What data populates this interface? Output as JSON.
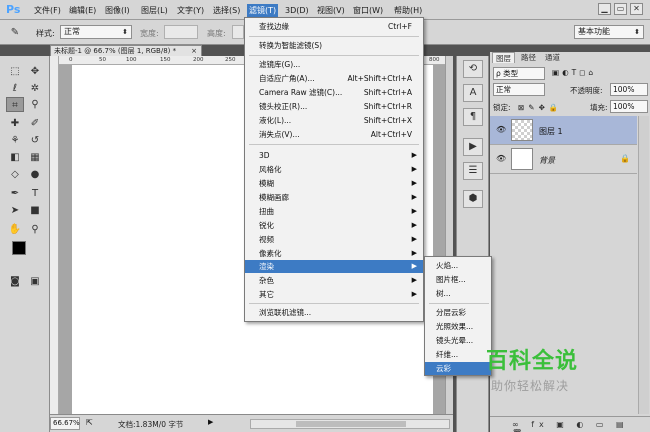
{
  "app": {
    "logo": "Ps"
  },
  "menubar": {
    "items": [
      "文件(F)",
      "编辑(E)",
      "图像(I)",
      "图层(L)",
      "文字(Y)",
      "选择(S)",
      "滤镜(T)",
      "3D(D)",
      "视图(V)",
      "窗口(W)",
      "帮助(H)"
    ],
    "window_buttons": [
      "▁",
      "▭",
      "✕"
    ]
  },
  "options": {
    "style_label": "样式:",
    "style_value": "正常",
    "width_label": "宽度:",
    "height_label": "高度:",
    "workspace": "基本功能"
  },
  "document": {
    "tab_title": "未标题-1 @ 66.7% (图层 1, RGB/8) *",
    "close": "×",
    "ruler_ticks": [
      "0",
      "50",
      "100",
      "150",
      "200",
      "250",
      "300",
      "350"
    ],
    "ruler_right_tick": "800",
    "zoom": "66.67%",
    "doc_info": "文档:1.83M/0 字节"
  },
  "filter_menu": {
    "items": [
      {
        "label": "查找边缘",
        "shortcut": "Ctrl+F"
      },
      {
        "label": "转换为智能滤镜(S)"
      },
      {
        "label": "滤镜库(G)..."
      },
      {
        "label": "自适应广角(A)...",
        "shortcut": "Alt+Shift+Ctrl+A"
      },
      {
        "label": "Camera Raw 滤镜(C)...",
        "shortcut": "Shift+Ctrl+A"
      },
      {
        "label": "镜头校正(R)...",
        "shortcut": "Shift+Ctrl+R"
      },
      {
        "label": "液化(L)...",
        "shortcut": "Shift+Ctrl+X"
      },
      {
        "label": "消失点(V)...",
        "shortcut": "Alt+Ctrl+V"
      },
      {
        "label": "3D"
      },
      {
        "label": "风格化"
      },
      {
        "label": "模糊"
      },
      {
        "label": "模糊画廊"
      },
      {
        "label": "扭曲"
      },
      {
        "label": "锐化"
      },
      {
        "label": "视频"
      },
      {
        "label": "像素化"
      },
      {
        "label": "渲染"
      },
      {
        "label": "杂色"
      },
      {
        "label": "其它"
      },
      {
        "label": "浏览联机滤镜..."
      }
    ]
  },
  "render_submenu": {
    "items": [
      "火焰...",
      "图片框...",
      "树...",
      "分层云彩",
      "光照效果...",
      "镜头光晕...",
      "纤维...",
      "云彩"
    ]
  },
  "panels": {
    "tabs": [
      "图层",
      "路径",
      "通道"
    ],
    "kind": "ρ 类型",
    "blend_mode": "正常",
    "opacity_label": "不透明度:",
    "opacity_value": "100%",
    "lock_label": "锁定:",
    "fill_label": "填充:",
    "fill_value": "100%",
    "layers": [
      {
        "name": "图层 1",
        "selected": true
      },
      {
        "name": "背景",
        "locked": true
      }
    ],
    "bottom_icons": "∞  fx  ▣  ◐  ▭  ▤  🗑"
  },
  "watermark": {
    "title": "百科全说",
    "subtitle": "助你轻松解决"
  },
  "colors": {
    "accent": "#3d7bc4",
    "watermark_green": "#3bbf3b",
    "layer_selected": "#a8b7d8"
  }
}
